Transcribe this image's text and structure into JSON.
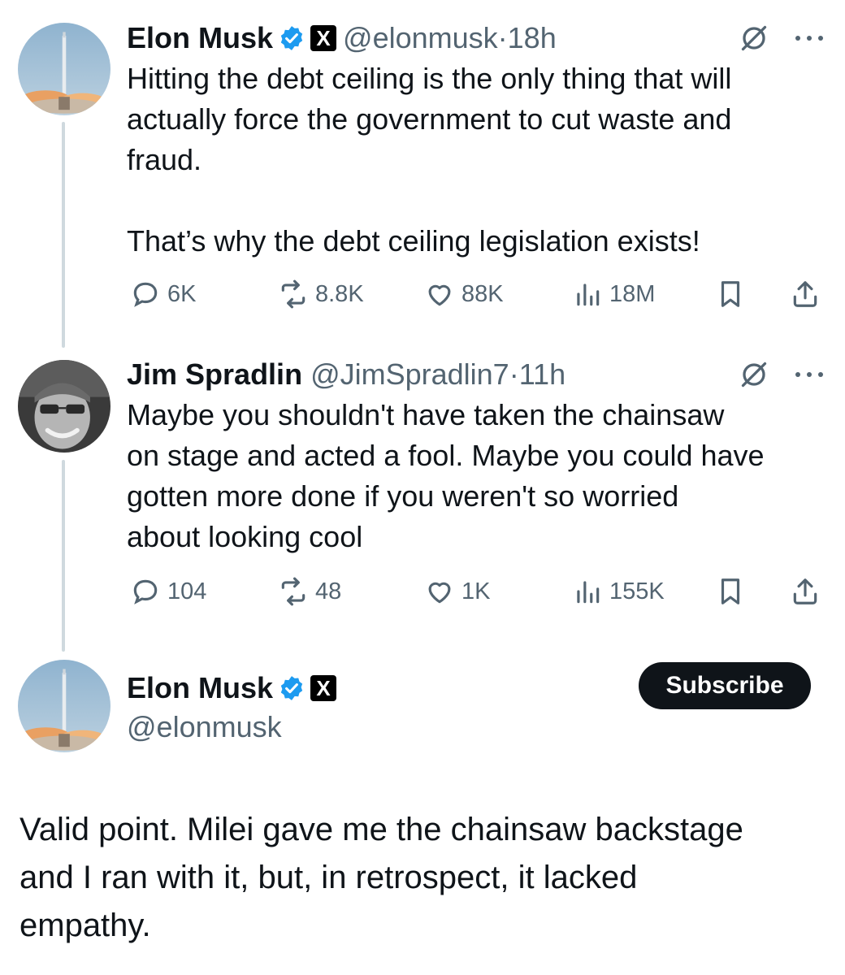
{
  "colors": {
    "text": "#0f1419",
    "muted": "#536471",
    "verified": "#1d9bf0",
    "line": "#cfd9de"
  },
  "thread": [
    {
      "author": {
        "name": "Elon Musk",
        "handle": "@elonmusk",
        "verified": true,
        "affiliate_badge": "X"
      },
      "time": "18h",
      "separator": "·",
      "text": "Hitting the debt ceiling is the only thing that will\nactually force the government to cut waste and\nfraud.\n\nThat’s why the debt ceiling legislation exists!",
      "stats": {
        "replies": "6K",
        "reposts": "8.8K",
        "likes": "88K",
        "views": "18M"
      }
    },
    {
      "author": {
        "name": "Jim Spradlin",
        "handle": "@JimSpradlin7",
        "verified": false
      },
      "time": "11h",
      "separator": "·",
      "text": "Maybe you shouldn't have taken the chainsaw\non stage and acted a fool. Maybe you could have\ngotten more done if you weren't so worried\nabout looking cool",
      "stats": {
        "replies": "104",
        "reposts": "48",
        "likes": "1K",
        "views": "155K"
      }
    }
  ],
  "main_post": {
    "author": {
      "name": "Elon Musk",
      "handle": "@elonmusk",
      "verified": true,
      "affiliate_badge": "X"
    },
    "subscribe_label": "Subscribe",
    "text": "Valid point. Milei gave me the chainsaw backstage\nand I ran with it, but, in retrospect, it lacked\nempathy."
  },
  "icons": [
    "verified-badge-icon",
    "x-logo-icon",
    "grok-icon",
    "more-icon",
    "reply-icon",
    "repost-icon",
    "like-icon",
    "views-icon",
    "bookmark-icon",
    "share-icon"
  ]
}
